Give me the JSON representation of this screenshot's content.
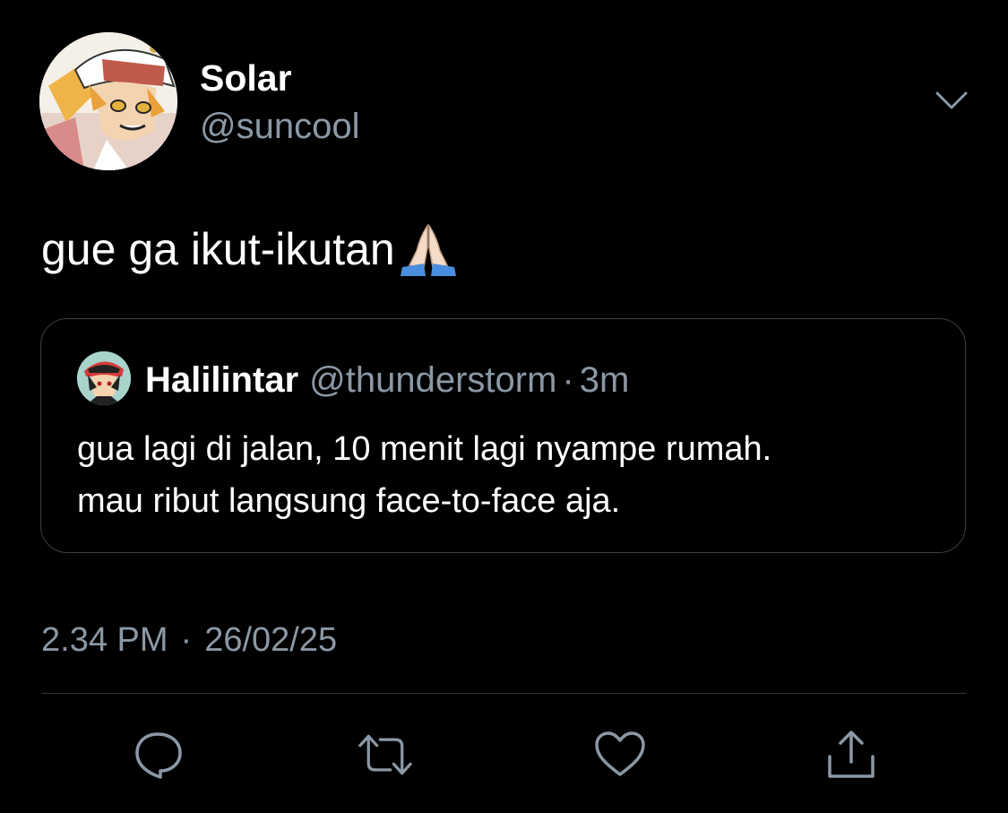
{
  "user": {
    "display_name": "Solar",
    "handle": "@suncool",
    "avatar_icon": "anime-character-avatar"
  },
  "tweet": {
    "text": "gue ga ikut-ikutan",
    "emoji_icon": "folded-hands-emoji"
  },
  "quoted_tweet": {
    "display_name": "Halilintar",
    "handle": "@thunderstorm",
    "separator": "·",
    "time": "3m",
    "lines": [
      "gua lagi di jalan, 10 menit lagi nyampe rumah.",
      "mau ribut langsung face-to-face aja."
    ]
  },
  "meta": {
    "time": "2.34 PM",
    "separator": "·",
    "date": "26/02/25"
  },
  "actions": {
    "reply_icon": "reply-icon",
    "retweet_icon": "retweet-icon",
    "like_icon": "heart-icon",
    "share_icon": "share-icon"
  },
  "colors": {
    "background": "#000000",
    "text_primary": "#ffffff",
    "text_secondary": "#8b98a5",
    "border": "#3a3f45"
  }
}
